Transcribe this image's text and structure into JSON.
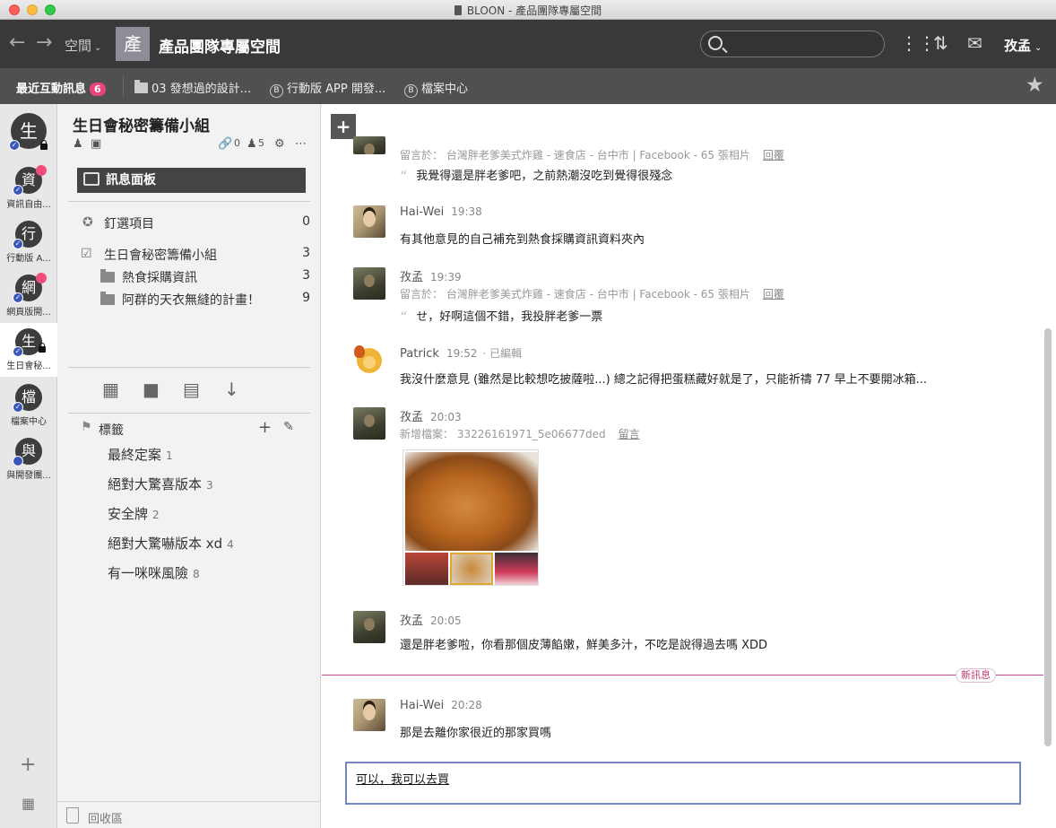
{
  "window": {
    "title": "BLOON - 產品團隊專屬空間"
  },
  "toolbar": {
    "back_icon": "arrow-left-icon",
    "forward_icon": "arrow-right-icon",
    "space_label": "空間",
    "space_avatar": "產",
    "space_name": "產品團隊專屬空間",
    "search_placeholder": "",
    "user_name": "孜孟"
  },
  "bookmarks": {
    "recent_label": "最近互動訊息",
    "recent_count": "6",
    "items": [
      {
        "label": "03 發想過的設計...",
        "icon": "folder-icon"
      },
      {
        "label": "行動版 APP 開發...",
        "icon": "b-circle-icon"
      },
      {
        "label": "檔案中心",
        "icon": "b-circle-icon"
      }
    ]
  },
  "rail": {
    "top_avatar": "生",
    "items": [
      {
        "glyph": "資",
        "label": "資訊自由...",
        "unread": true,
        "checked": true
      },
      {
        "glyph": "行",
        "label": "行動版 A...",
        "unread": false,
        "checked": true
      },
      {
        "glyph": "網",
        "label": "網頁版開...",
        "unread": true,
        "checked": true
      },
      {
        "glyph": "生",
        "label": "生日會秘...",
        "unread": false,
        "checked": true,
        "locked": true,
        "active": true
      },
      {
        "glyph": "檔",
        "label": "檔案中心",
        "unread": false,
        "checked": true
      },
      {
        "glyph": "與",
        "label": "與開發團...",
        "unread": false,
        "dot": true
      }
    ]
  },
  "sidebar": {
    "title": "生日會秘密籌備小組",
    "links_count": "0",
    "members_count": "5",
    "board_label": "訊息面板",
    "pinned": {
      "label": "釘選項目",
      "count": "0"
    },
    "group": {
      "label": "生日會秘密籌備小組",
      "count": "3"
    },
    "folders": [
      {
        "label": "熱食採購資訊",
        "count": "3"
      },
      {
        "label": "阿群的天衣無縫的計畫！",
        "count": "9"
      }
    ],
    "tags_label": "標籤",
    "tags": [
      {
        "label": "最終定案",
        "count": "1"
      },
      {
        "label": "絕對大驚喜版本",
        "count": "3"
      },
      {
        "label": "安全牌",
        "count": "2"
      },
      {
        "label": "絕對大驚嚇版本 xd",
        "count": "4"
      },
      {
        "label": "有一咪咪風險",
        "count": "8"
      }
    ],
    "recycle_label": "回收區"
  },
  "chat": {
    "messages": [
      {
        "ref_prefix": "留言於：",
        "ref": "台灣胖老爹美式炸雞 - 速食店 - 台中市 | Facebook - 65 張相片",
        "reply": "回覆",
        "body": "我覺得還是胖老爹吧，之前熱潮沒吃到覺得很殘念"
      },
      {
        "name": "Hai-Wei",
        "time": "19:38",
        "body": "有其他意見的自己補充到熱食採購資訊資料夾內"
      },
      {
        "name": "孜孟",
        "time": "19:39",
        "ref_prefix": "留言於：",
        "ref": "台灣胖老爹美式炸雞 - 速食店 - 台中市 | Facebook - 65 張相片",
        "reply": "回覆",
        "body": "せ，好啊這個不錯，我投胖老爹一票"
      },
      {
        "name": "Patrick",
        "time": "19:52",
        "edited": "· 已編輯",
        "body": "我沒什麼意見 (雖然是比較想吃披薩啦...) 總之記得把蛋糕藏好就是了，只能祈禱 77 早上不要開冰箱..."
      },
      {
        "name": "孜孟",
        "time": "20:03",
        "file_prefix": "新增檔案：",
        "file": "33226161971_5e06677ded",
        "reply": "留言"
      },
      {
        "name": "孜孟",
        "time": "20:05",
        "body": "還是胖老爹啦，你看那個皮薄餡嫩，鮮美多汁，不吃是說得過去嗎 XDD"
      },
      {
        "name": "Hai-Wei",
        "time": "20:28",
        "body": "那是去離你家很近的那家買嗎"
      }
    ],
    "new_marker": "新訊息",
    "compose_text": "可以，我可以去買"
  }
}
